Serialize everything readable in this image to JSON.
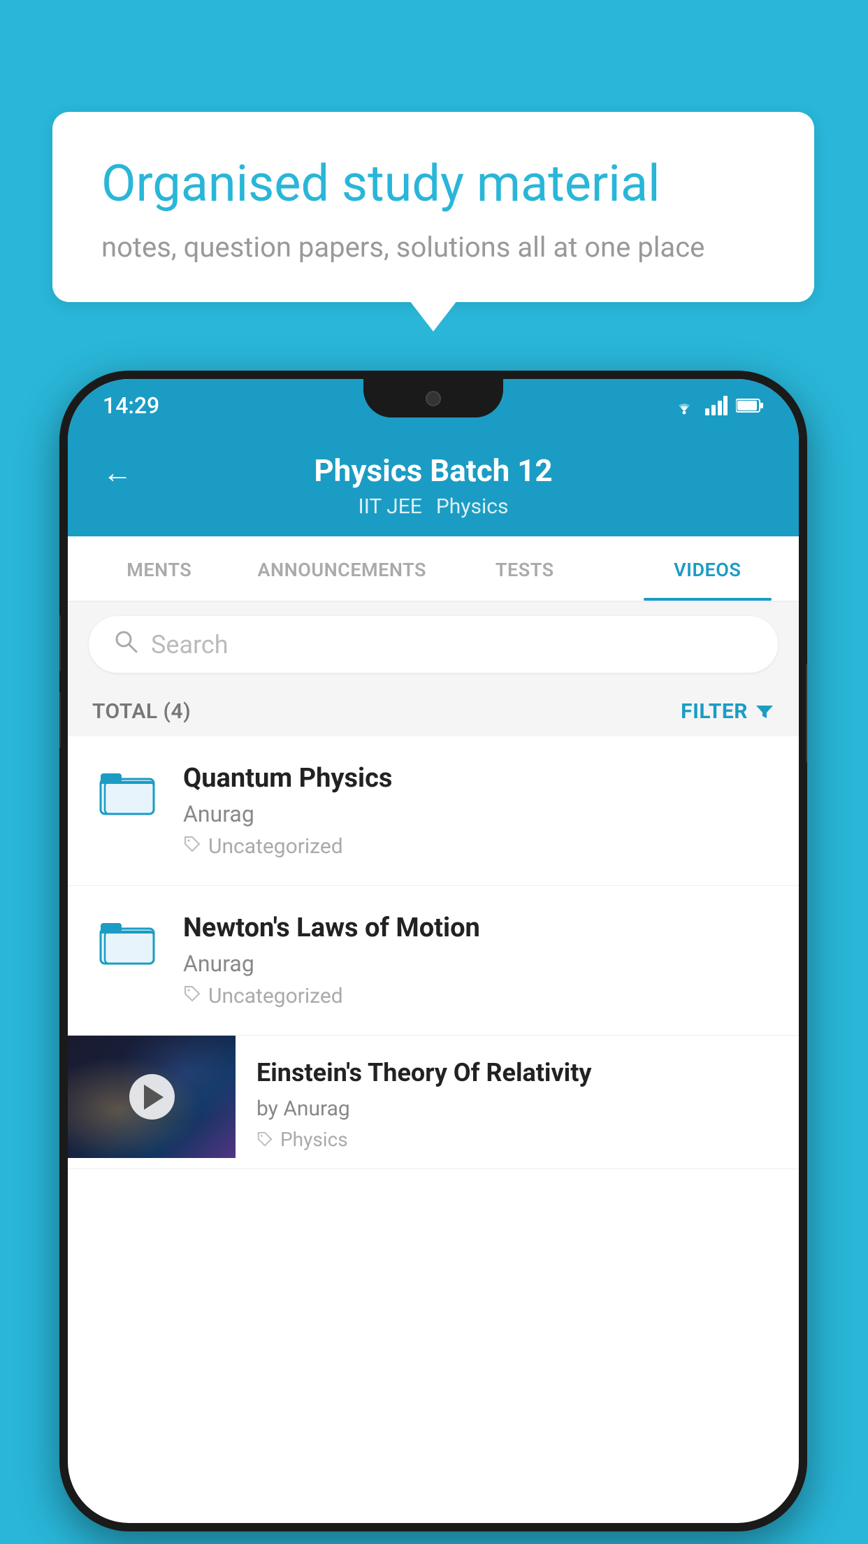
{
  "background_color": "#29b6d8",
  "bubble": {
    "title": "Organised study material",
    "subtitle": "notes, question papers, solutions all at one place"
  },
  "phone": {
    "status_bar": {
      "time": "14:29"
    },
    "header": {
      "title": "Physics Batch 12",
      "subtitle1": "IIT JEE",
      "subtitle2": "Physics",
      "back_label": "←"
    },
    "tabs": [
      {
        "label": "MENTS",
        "active": false
      },
      {
        "label": "ANNOUNCEMENTS",
        "active": false
      },
      {
        "label": "TESTS",
        "active": false
      },
      {
        "label": "VIDEOS",
        "active": true
      }
    ],
    "search": {
      "placeholder": "Search"
    },
    "filter": {
      "total_label": "TOTAL (4)",
      "filter_label": "FILTER"
    },
    "videos": [
      {
        "title": "Quantum Physics",
        "author": "Anurag",
        "tag": "Uncategorized",
        "has_thumb": false
      },
      {
        "title": "Newton's Laws of Motion",
        "author": "Anurag",
        "tag": "Uncategorized",
        "has_thumb": false
      },
      {
        "title": "Einstein's Theory Of Relativity",
        "author": "by Anurag",
        "tag": "Physics",
        "has_thumb": true
      }
    ]
  }
}
